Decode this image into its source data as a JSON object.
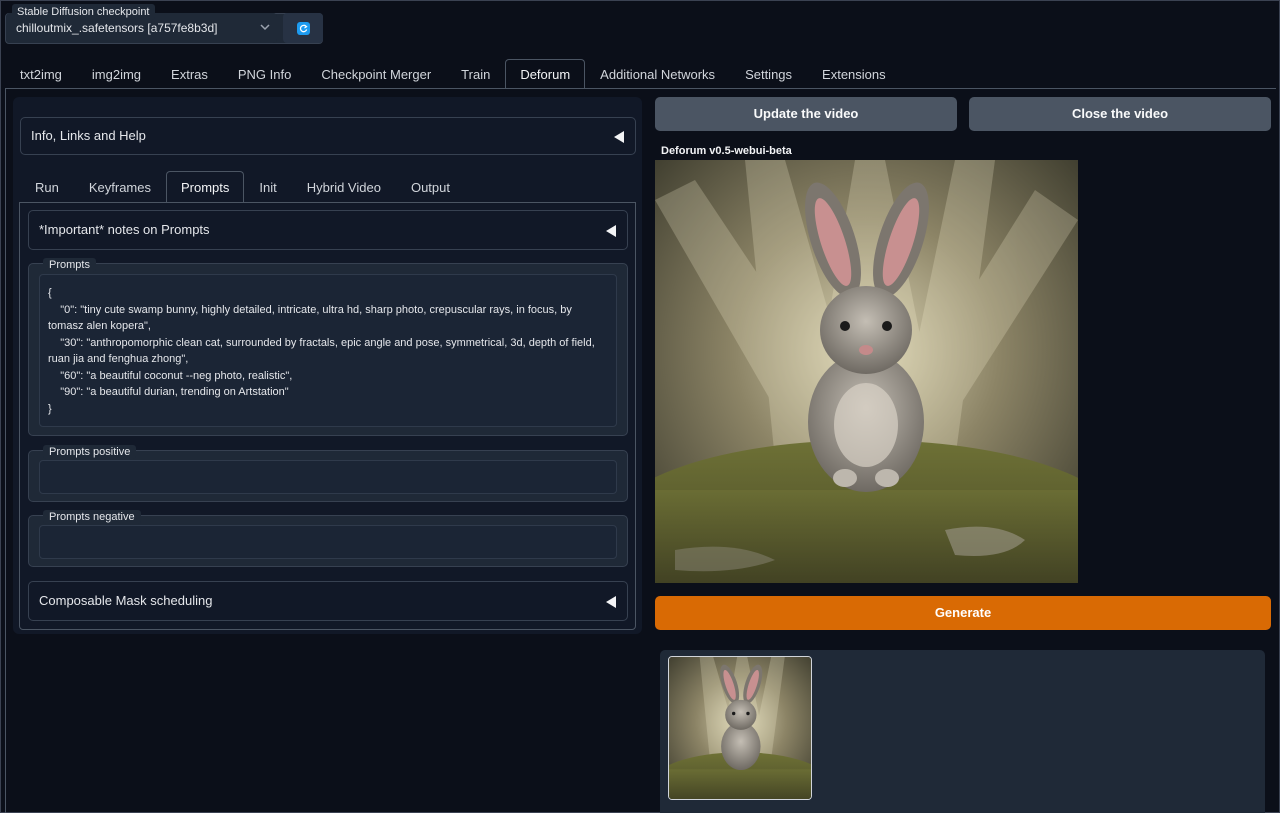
{
  "checkpoint": {
    "label": "Stable Diffusion checkpoint",
    "value": "chilloutmix_.safetensors [a757fe8b3d]"
  },
  "main_tabs": [
    {
      "label": "txt2img"
    },
    {
      "label": "img2img"
    },
    {
      "label": "Extras"
    },
    {
      "label": "PNG Info"
    },
    {
      "label": "Checkpoint Merger"
    },
    {
      "label": "Train"
    },
    {
      "label": "Deforum"
    },
    {
      "label": "Additional Networks"
    },
    {
      "label": "Settings"
    },
    {
      "label": "Extensions"
    }
  ],
  "active_main_tab": "Deforum",
  "left": {
    "info_accordion": "Info, Links and Help",
    "sub_tabs": [
      {
        "label": "Run"
      },
      {
        "label": "Keyframes"
      },
      {
        "label": "Prompts"
      },
      {
        "label": "Init"
      },
      {
        "label": "Hybrid Video"
      },
      {
        "label": "Output"
      }
    ],
    "active_sub_tab": "Prompts",
    "notes_accordion": "*Important* notes on Prompts",
    "prompts": {
      "label": "Prompts",
      "value": "{\n    \"0\": \"tiny cute swamp bunny, highly detailed, intricate, ultra hd, sharp photo, crepuscular rays, in focus, by tomasz alen kopera\",\n    \"30\": \"anthropomorphic clean cat, surrounded by fractals, epic angle and pose, symmetrical, 3d, depth of field, ruan jia and fenghua zhong\",\n    \"60\": \"a beautiful coconut --neg photo, realistic\",\n    \"90\": \"a beautiful durian, trending on Artstation\"\n}"
    },
    "prompts_positive": {
      "label": "Prompts positive",
      "value": ""
    },
    "prompts_negative": {
      "label": "Prompts negative",
      "value": ""
    },
    "mask_accordion": "Composable Mask scheduling"
  },
  "right": {
    "update_video_label": "Update the video",
    "close_video_label": "Close the video",
    "video_title": "Deforum v0.5-webui-beta",
    "generate_label": "Generate"
  },
  "colors": {
    "background": "#0b0f19",
    "panel": "#111827",
    "block": "#1f2937",
    "generate": "#d96a04",
    "button": "#4b5563"
  }
}
